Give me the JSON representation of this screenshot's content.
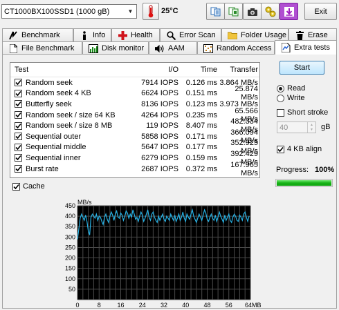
{
  "toolbar": {
    "drive": "CT1000BX100SSD1 (1000 gB)",
    "temperature": "25°C",
    "exit_label": "Exit",
    "icons": [
      "copy-text-icon",
      "copy-info-icon",
      "screenshot-camera-icon",
      "options-icon",
      "download-icon"
    ]
  },
  "tabs": {
    "row1": [
      "Benchmark",
      "Info",
      "Health",
      "Error Scan",
      "Folder Usage",
      "Erase"
    ],
    "row2": [
      "File Benchmark",
      "Disk monitor",
      "AAM",
      "Random Access",
      "Extra tests"
    ],
    "active": "Extra tests"
  },
  "results": {
    "columns": [
      "Test",
      "I/O",
      "Time",
      "Transfer"
    ],
    "rows": [
      {
        "test": "Random seek",
        "io": "7914 IOPS",
        "time": "0.126 ms",
        "transfer": "3.864 MB/s",
        "checked": true
      },
      {
        "test": "Random seek 4 KB",
        "io": "6624 IOPS",
        "time": "0.151 ms",
        "transfer": "25.874 MB/s",
        "checked": true
      },
      {
        "test": "Butterfly seek",
        "io": "8136 IOPS",
        "time": "0.123 ms",
        "transfer": "3.973 MB/s",
        "checked": true
      },
      {
        "test": "Random seek / size 64 KB",
        "io": "4264 IOPS",
        "time": "0.235 ms",
        "transfer": "65.566 MB/s",
        "checked": true
      },
      {
        "test": "Random seek / size 8 MB",
        "io": "119 IOPS",
        "time": "8.407 ms",
        "transfer": "482.334 MB/s",
        "checked": true
      },
      {
        "test": "Sequential outer",
        "io": "5858 IOPS",
        "time": "0.171 ms",
        "transfer": "366.094 MB/s",
        "checked": true
      },
      {
        "test": "Sequential middle",
        "io": "5647 IOPS",
        "time": "0.177 ms",
        "transfer": "352.925 MB/s",
        "checked": true
      },
      {
        "test": "Sequential inner",
        "io": "6279 IOPS",
        "time": "0.159 ms",
        "transfer": "392.429 MB/s",
        "checked": true
      },
      {
        "test": "Burst rate",
        "io": "2687 IOPS",
        "time": "0.372 ms",
        "transfer": "167.965 MB/s",
        "checked": true
      }
    ]
  },
  "controls": {
    "start_label": "Start",
    "read_label": "Read",
    "write_label": "Write",
    "mode": "Read",
    "short_stroke_label": "Short stroke",
    "short_stroke_checked": false,
    "short_stroke_value": "40",
    "short_stroke_unit": "gB",
    "align_label": "4 KB align",
    "align_checked": true,
    "progress_label": "Progress:",
    "progress_value": "100%",
    "progress_fraction": 1.0,
    "cache_label": "Cache",
    "cache_checked": true
  },
  "chart_data": {
    "type": "line",
    "ylabel": "MB/s",
    "xlabel": "",
    "x_tick_labels": [
      "0",
      "8",
      "16",
      "24",
      "32",
      "40",
      "48",
      "56",
      "64MB"
    ],
    "y_tick_labels": [
      "450",
      "400",
      "350",
      "300",
      "250",
      "200",
      "150",
      "100",
      "50"
    ],
    "xlim": [
      0,
      64
    ],
    "ylim": [
      0,
      450
    ],
    "series": [
      {
        "color": "#27b3e6",
        "x": [
          0,
          0.5,
          1,
          1.5,
          2,
          2.5,
          3,
          3.5,
          4,
          4.5,
          5,
          5.5,
          6,
          6.5,
          7,
          7.5,
          8,
          8.5,
          9,
          9.5,
          10,
          10.5,
          11,
          11.5,
          12,
          12.5,
          13,
          13.5,
          14,
          14.5,
          15,
          15.5,
          16,
          16.5,
          17,
          17.5,
          18,
          18.5,
          19,
          19.5,
          20,
          20.5,
          21,
          21.5,
          22,
          22.5,
          23,
          23.5,
          24,
          24.5,
          25,
          25.5,
          26,
          26.5,
          27,
          27.5,
          28,
          28.5,
          29,
          29.5,
          30,
          30.5,
          31,
          31.5,
          32,
          32.5,
          33,
          33.5,
          34,
          34.5,
          35,
          35.5,
          36,
          36.5,
          37,
          37.5,
          38,
          38.5,
          39,
          39.5,
          40,
          40.5,
          41,
          41.5,
          42,
          42.5,
          43,
          43.5,
          44,
          44.5,
          45,
          45.5,
          46,
          46.5,
          47,
          47.5,
          48,
          48.5,
          49,
          49.5,
          50,
          50.5,
          51,
          51.5,
          52,
          52.5,
          53,
          53.5,
          54,
          54.5,
          55,
          55.5,
          56,
          56.5,
          57,
          57.5,
          58,
          58.5,
          59,
          59.5,
          60,
          60.5,
          61,
          61.5,
          62,
          62.5,
          63,
          63.5
        ],
        "y": [
          290,
          340,
          390,
          410,
          395,
          380,
          405,
          375,
          330,
          310,
          395,
          410,
          400,
          390,
          410,
          380,
          400,
          395,
          375,
          360,
          395,
          410,
          385,
          370,
          400,
          420,
          405,
          380,
          410,
          425,
          395,
          390,
          415,
          405,
          380,
          400,
          425,
          415,
          390,
          410,
          395,
          430,
          410,
          385,
          395,
          375,
          400,
          420,
          405,
          375,
          390,
          410,
          430,
          395,
          380,
          410,
          420,
          395,
          380,
          370,
          400,
          380,
          395,
          410,
          385,
          375,
          400,
          390,
          380,
          410,
          395,
          380,
          405,
          375,
          390,
          410,
          380,
          395,
          420,
          390,
          375,
          410,
          395,
          385,
          410,
          430,
          400,
          385,
          370,
          390,
          410,
          395,
          380,
          405,
          430,
          415,
          385,
          375,
          395,
          410,
          390,
          380,
          405,
          375,
          395,
          420,
          400,
          385,
          370,
          405,
          380,
          395,
          410,
          380,
          370,
          395,
          410,
          400,
          380,
          375,
          405,
          395,
          380,
          410,
          420,
          395,
          375,
          400
        ]
      }
    ]
  }
}
